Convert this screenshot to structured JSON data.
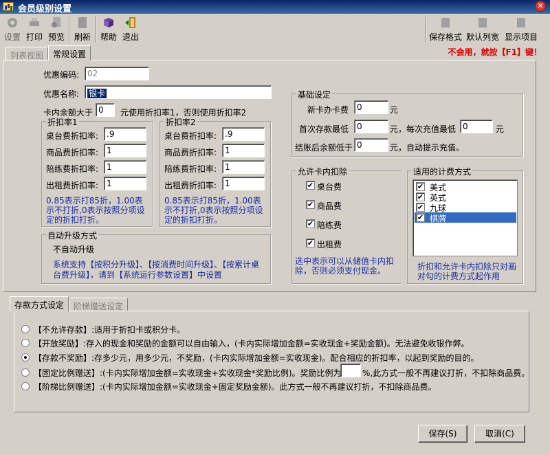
{
  "window": {
    "title": "会员级别设置",
    "close": "✕"
  },
  "toolbar": {
    "left": [
      {
        "name": "settings-button",
        "label": "设置",
        "icon": "gear-icon"
      },
      {
        "name": "print-button",
        "label": "打印",
        "icon": "printer-icon"
      },
      {
        "name": "preview-button",
        "label": "预览",
        "icon": "preview-icon"
      },
      {
        "name": "refresh-button",
        "label": "刷新",
        "icon": "refresh-icon"
      },
      {
        "name": "help-button",
        "label": "帮助",
        "icon": "book-icon"
      },
      {
        "name": "exit-button",
        "label": "退出",
        "icon": "exit-door-icon"
      }
    ],
    "right": [
      {
        "name": "save-format-button",
        "label": "保存格式"
      },
      {
        "name": "default-columns-button",
        "label": "默认列宽"
      },
      {
        "name": "show-items-button",
        "label": "显示项目"
      }
    ],
    "warning": "不会用，就按【F1】键！"
  },
  "tabs": {
    "list_view": "列表视图",
    "general": "常规设置"
  },
  "form": {
    "code_label": "优惠编码:",
    "code_value": "02",
    "name_label": "优惠名称:",
    "name_value": "银卡",
    "balance_prefix": "卡内余额大于",
    "balance_value": "0",
    "balance_suffix": "元使用折扣率1，否则使用折扣率2"
  },
  "rate1": {
    "title": "折扣率1",
    "rows": [
      {
        "label": "桌台费折扣率:",
        "value": ".9"
      },
      {
        "label": "商品费折扣率:",
        "value": "1"
      },
      {
        "label": "陪练费折扣率:",
        "value": "1"
      },
      {
        "label": "出租费折扣率:",
        "value": "1"
      }
    ],
    "note": "0.85表示打85折，1.00表示不打折,0表示按照分项设定的折扣打折。"
  },
  "rate2": {
    "title": "折扣率2",
    "rows": [
      {
        "label": "桌台费折扣率:",
        "value": ".9"
      },
      {
        "label": "商品费折扣率:",
        "value": "1"
      },
      {
        "label": "陪练费折扣率:",
        "value": "1"
      },
      {
        "label": "出租费折扣率:",
        "value": "1"
      }
    ],
    "note": "0.85表示打85折，1.00表示不打折,0表示按照分项设定的折扣打折。"
  },
  "auto_upgrade": {
    "title": "自动升级方式",
    "value": "不自动升级",
    "note": "系统支持【按积分升级】、【按消费时间升级】、【按累计桌台费升级】，请到【系统运行参数设置】中设置"
  },
  "basic": {
    "title": "基础设定",
    "new_card_label": "新卡办卡费",
    "new_card_value": "0",
    "new_card_unit": "元",
    "first_deposit_label": "首次存款最低",
    "first_deposit_value": "0",
    "first_deposit_mid": "元，每次充值最低",
    "each_deposit_value": "0",
    "each_deposit_unit": "元",
    "balance_low_label": "结账后余额低于",
    "balance_low_value": "0",
    "balance_low_suffix": "元，自动提示充值。"
  },
  "deduct": {
    "title": "允许卡内扣除",
    "items": [
      {
        "label": "桌台费",
        "checked": true
      },
      {
        "label": "商品费",
        "checked": true
      },
      {
        "label": "陪练费",
        "checked": true
      },
      {
        "label": "出租费",
        "checked": true
      }
    ],
    "note": "选中表示可以从储值卡内扣除，否则必须支付现金。"
  },
  "billing": {
    "title": "适用的计费方式",
    "items": [
      {
        "label": "美式",
        "checked": true,
        "selected": false
      },
      {
        "label": "英式",
        "checked": true,
        "selected": false
      },
      {
        "label": "九球",
        "checked": true,
        "selected": false
      },
      {
        "label": "棋牌",
        "checked": true,
        "selected": true
      }
    ],
    "note": "折扣和允许卡内扣除只对画对勾的计费方式起作用"
  },
  "deposit_tabs": {
    "deposit_method": "存款方式设定",
    "ladder_gift": "阶梯赠送设定"
  },
  "deposit_options": [
    {
      "bold": "【不允许存款】",
      "text": ":适用于折扣卡或积分卡。",
      "selected": false
    },
    {
      "bold": "【开放奖励】",
      "text": ":存入的现金和奖励的金额可以自由输入，(卡内实际增加金额=实收现金+奖励金额)。无法避免收银作弊。",
      "selected": false
    },
    {
      "bold": "【存款不奖励】",
      "text": ":存多少元，用多少元，不奖励，(卡内实际增加金额=实收现金)。配合相应的折扣率，以起到奖励的目的。",
      "selected": true
    },
    {
      "bold": "【固定比例赠送】",
      "text": ":(卡内实际增加金额=实收现金+实收现金*奖励比例)。奖励比例为",
      "selected": false,
      "ratio_value": "",
      "ratio_suffix": "%,此方式一般不再建议打折，不扣除商品费。"
    },
    {
      "bold": "【阶梯比例赠送】",
      "text": ":(卡内实际增加金额=实收现金+固定奖励金额)。此方式一般不再建议打折，不扣除商品费。",
      "selected": false
    }
  ],
  "footer": {
    "save": "保存(S)",
    "cancel": "取消(C)"
  }
}
